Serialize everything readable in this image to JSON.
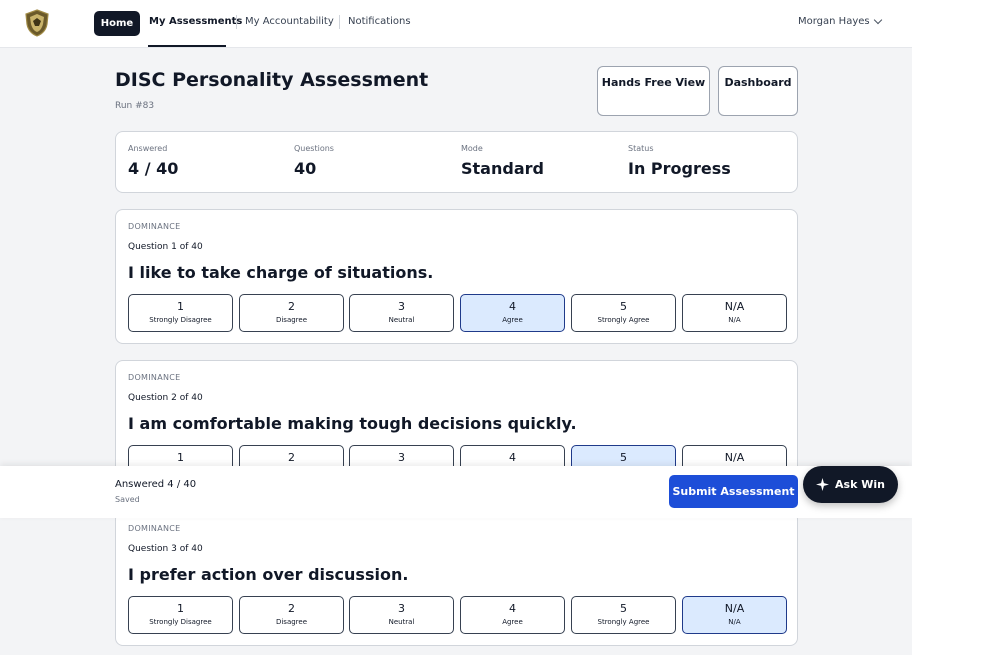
{
  "nav": {
    "logo_icon": "shield-logo-icon",
    "home": "Home",
    "links": [
      "My Assessments",
      "My Accountability",
      "Notifications"
    ],
    "active": "My Assessments",
    "user": "Morgan Hayes"
  },
  "header": {
    "title": "DISC Personality Assessment",
    "run": "Run #83",
    "hands_free": "Hands Free View",
    "dashboard": "Dashboard"
  },
  "stats": {
    "answered_label": "Answered",
    "answered_value": "4 / 40",
    "questions_label": "Questions",
    "questions_value": "40",
    "mode_label": "Mode",
    "mode_value": "Standard",
    "status_label": "Status",
    "status_value": "In Progress"
  },
  "options": [
    {
      "n": "1",
      "label": "Strongly Disagree"
    },
    {
      "n": "2",
      "label": "Disagree"
    },
    {
      "n": "3",
      "label": "Neutral"
    },
    {
      "n": "4",
      "label": "Agree"
    },
    {
      "n": "5",
      "label": "Strongly Agree"
    },
    {
      "n": "N/A",
      "label": "N/A"
    }
  ],
  "questions": [
    {
      "category": "DOMINANCE",
      "number": "Question 1 of 40",
      "text": "I like to take charge of situations.",
      "selected": "4"
    },
    {
      "category": "DOMINANCE",
      "number": "Question 2 of 40",
      "text": "I am comfortable making tough decisions quickly.",
      "selected": "5"
    },
    {
      "category": "DOMINANCE",
      "number": "Question 3 of 40",
      "text": "I prefer action over discussion.",
      "selected": "N/A"
    }
  ],
  "footer": {
    "answered": "Answered 4 / 40",
    "saved": "Saved",
    "submit": "Submit Assessment"
  },
  "assistant": {
    "label": "Ask Win",
    "icon": "sparkle-icon"
  },
  "colors": {
    "primary": "#1d4ed8",
    "dark": "#111827",
    "selected_bg": "#dbeafe",
    "page_bg": "#f3f4f6"
  }
}
